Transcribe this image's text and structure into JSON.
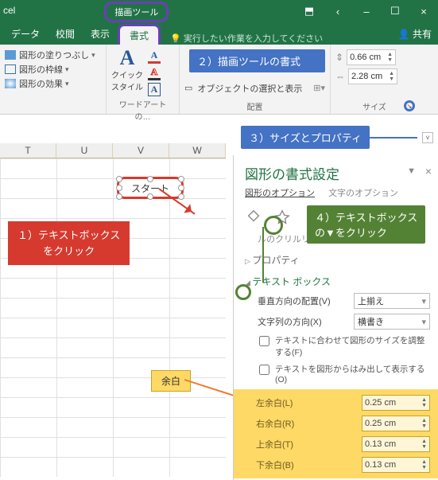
{
  "title": {
    "app": "cel",
    "contextTab": "描画ツール"
  },
  "window": {
    "min": "‒",
    "max": "☐",
    "close": "×",
    "ribbonToggle": "⬒",
    "helpArrow": "‹"
  },
  "tabs": {
    "data": "データ",
    "review": "校閲",
    "view": "表示",
    "format": "書式",
    "tellmeIcon": "💡",
    "tellme": "実行したい作業を入力してください",
    "share": "共有",
    "shareIcon": "👤"
  },
  "ribbon": {
    "shapeStyles": {
      "fill": "図形の塗りつぶし",
      "outline": "図形の枠線",
      "effects": "図形の効果",
      "group": ""
    },
    "wordart": {
      "quick": "クイック\nスタイル",
      "group": "ワードアートの…"
    },
    "arrange": {
      "selectionPane": "オブジェクトの選択と表示",
      "group": "配置"
    },
    "size": {
      "h": "0.66 cm",
      "w": "2.28 cm",
      "group": "サイズ"
    }
  },
  "callouts": {
    "c1": "１）テキストボックス\nをクリック",
    "c2": "２）描画ツールの書式",
    "c3": "３）サイズとプロパティ",
    "c4a": "４）テキストボックス",
    "c4b": "の▼をクリック",
    "margin": "余白"
  },
  "columns": [
    "T",
    "U",
    "V",
    "W"
  ],
  "shapeText": "スタート",
  "pane": {
    "title": "図形の書式設定",
    "opt1": "図形のオプション",
    "opt2": "文字のオプション",
    "fillLine": "ルのクリルリと線",
    "props": "プロパティ",
    "textbox": "テキスト ボックス",
    "vAlignLabel": "垂直方向の配置(V)",
    "vAlignAccess": "V",
    "vAlignVal": "上揃え",
    "textDirLabel": "文字列の方向(X)",
    "textDirAccess": "X",
    "textDirVal": "横書き",
    "autosize": "テキストに合わせて図形のサイズを調整する(F)",
    "overflow": "テキストを図形からはみ出して表示する(O)",
    "margins": {
      "l": {
        "label": "左余白(L)",
        "val": "0.25 cm"
      },
      "r": {
        "label": "右余白(R)",
        "val": "0.25 cm"
      },
      "t": {
        "label": "上余白(T)",
        "val": "0.13 cm"
      },
      "b": {
        "label": "下余白(B)",
        "val": "0.13 cm"
      }
    }
  }
}
